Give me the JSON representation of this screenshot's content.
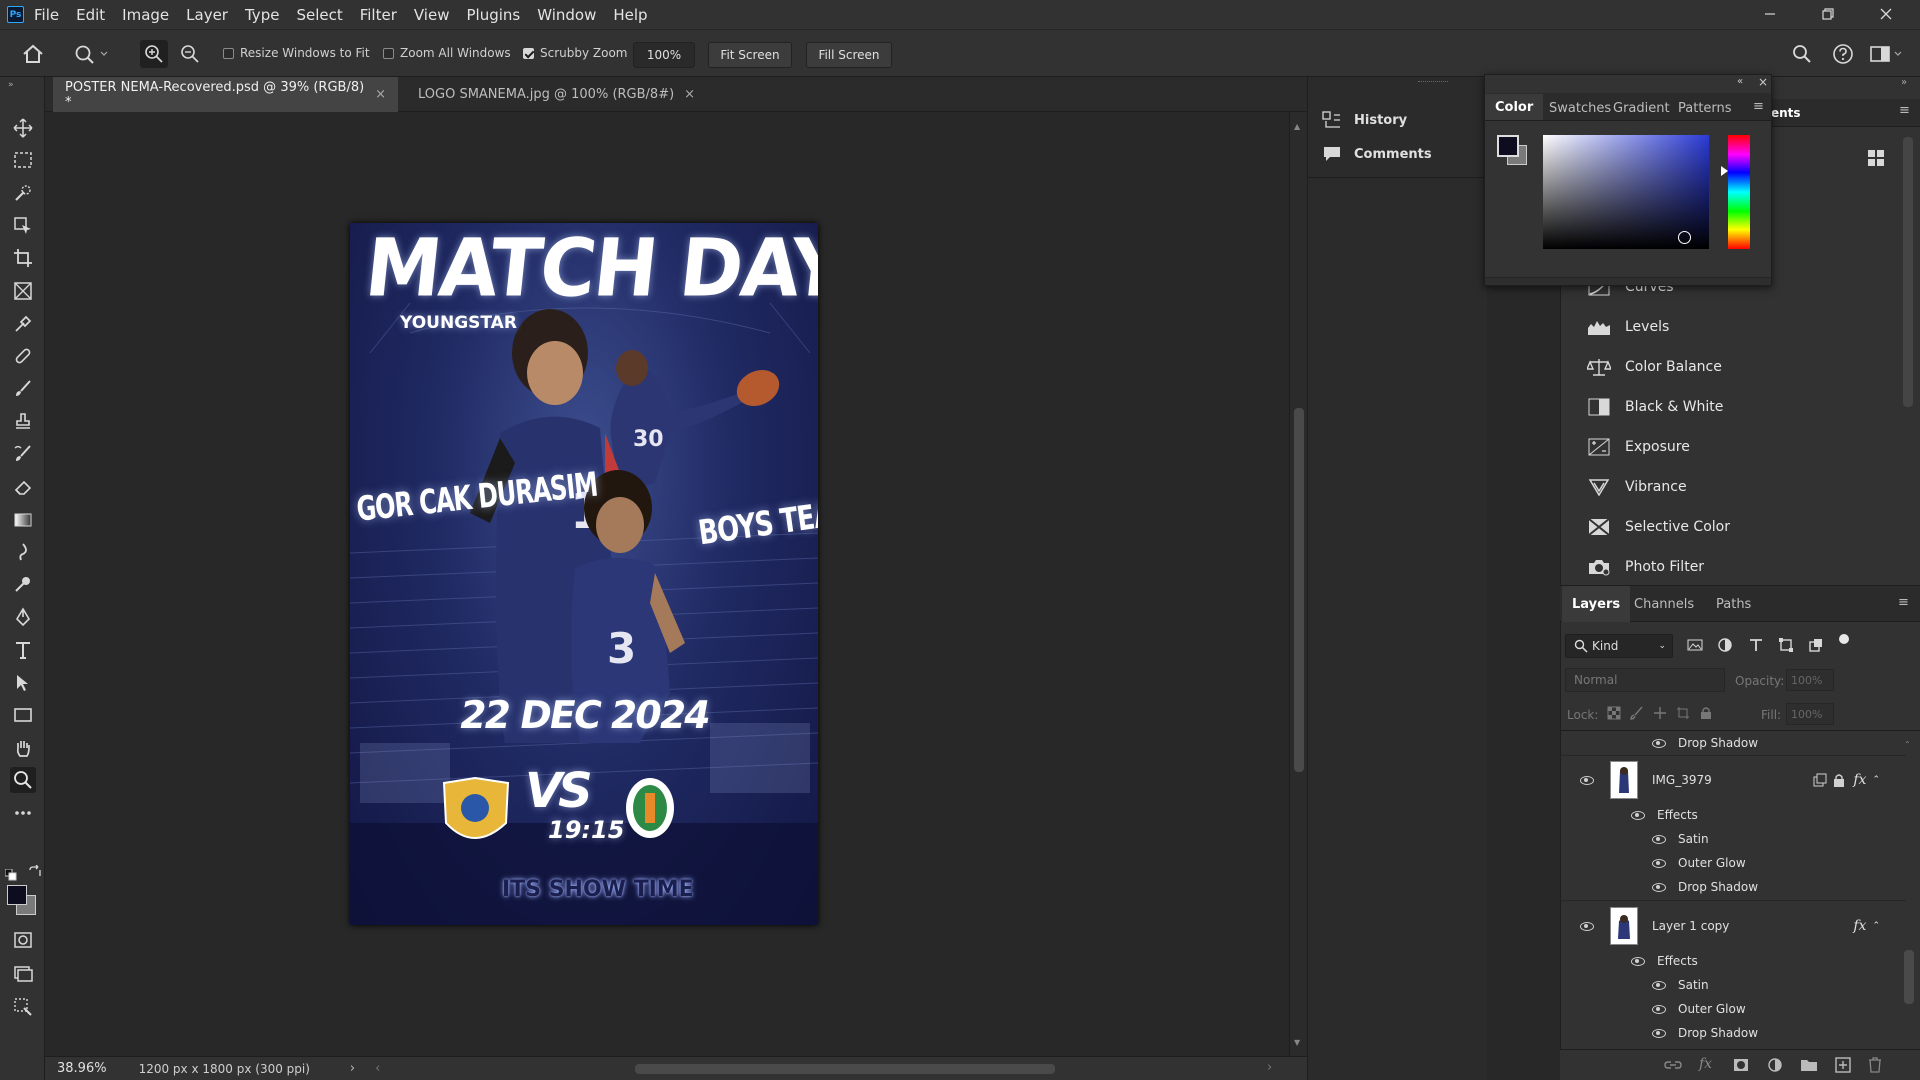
{
  "app": {
    "logo": "Ps",
    "menus": [
      "File",
      "Edit",
      "Image",
      "Layer",
      "Type",
      "Select",
      "Filter",
      "View",
      "Plugins",
      "Window",
      "Help"
    ]
  },
  "options": {
    "resize_windows": "Resize Windows to Fit",
    "zoom_all": "Zoom All Windows",
    "scrubby_zoom": "Scrubby Zoom",
    "zoom_value": "100%",
    "fit_screen": "Fit Screen",
    "fill_screen": "Fill Screen",
    "resize_checked": false,
    "zoom_all_checked": false,
    "scrubby_checked": true
  },
  "tabs": [
    {
      "label": "POSTER NEMA-Recovered.psd @ 39% (RGB/8) *",
      "active": true
    },
    {
      "label": "LOGO SMANEMA.jpg @ 100% (RGB/8#)",
      "active": false
    }
  ],
  "status": {
    "zoom": "38.96%",
    "doc_info": "1200 px x 1800 px (300 ppi)"
  },
  "poster": {
    "title": "MATCH DAY",
    "subtitle": "YOUNGSTAR",
    "left_text": "GOR CAK DURASIM",
    "right_text": "BOYS TEAM",
    "date": "22 DEC 2024",
    "vs": "VS",
    "time": "19:15",
    "tagline": "ITS SHOW TIME",
    "jersey_numbers": [
      "30",
      "1",
      "3"
    ]
  },
  "side_strip": {
    "history": "History",
    "comments": "Comments"
  },
  "color_panel": {
    "tabs": [
      "Color",
      "Swatches",
      "Gradient",
      "Patterns"
    ],
    "active_tab": "Color",
    "behind_tab_fragment": "ents",
    "foreground": "#0d0d1f",
    "background": "#7a7a7a",
    "hue_color": "#2a3ad6"
  },
  "adjustments": {
    "items": [
      "Curves",
      "Levels",
      "Color Balance",
      "Black & White",
      "Exposure",
      "Vibrance",
      "Selective Color",
      "Photo Filter"
    ]
  },
  "layers_panel": {
    "tabs": [
      "Layers",
      "Channels",
      "Paths"
    ],
    "kind": "Kind",
    "blend_mode": "Normal",
    "opacity_label": "Opacity:",
    "opacity_value": "100%",
    "lock_label": "Lock:",
    "fill_label": "Fill:",
    "fill_value": "100%",
    "rows": [
      {
        "type": "effect",
        "label": "Drop Shadow"
      },
      {
        "type": "layer",
        "label": "IMG_3979",
        "fx": "fx"
      },
      {
        "type": "effects-header",
        "label": "Effects"
      },
      {
        "type": "effect",
        "label": "Satin"
      },
      {
        "type": "effect",
        "label": "Outer Glow"
      },
      {
        "type": "effect",
        "label": "Drop Shadow"
      },
      {
        "type": "layer",
        "label": "Layer 1 copy",
        "fx": "fx"
      },
      {
        "type": "effects-header",
        "label": "Effects"
      },
      {
        "type": "effect",
        "label": "Satin"
      },
      {
        "type": "effect",
        "label": "Outer Glow"
      },
      {
        "type": "effect",
        "label": "Drop Shadow"
      }
    ]
  }
}
